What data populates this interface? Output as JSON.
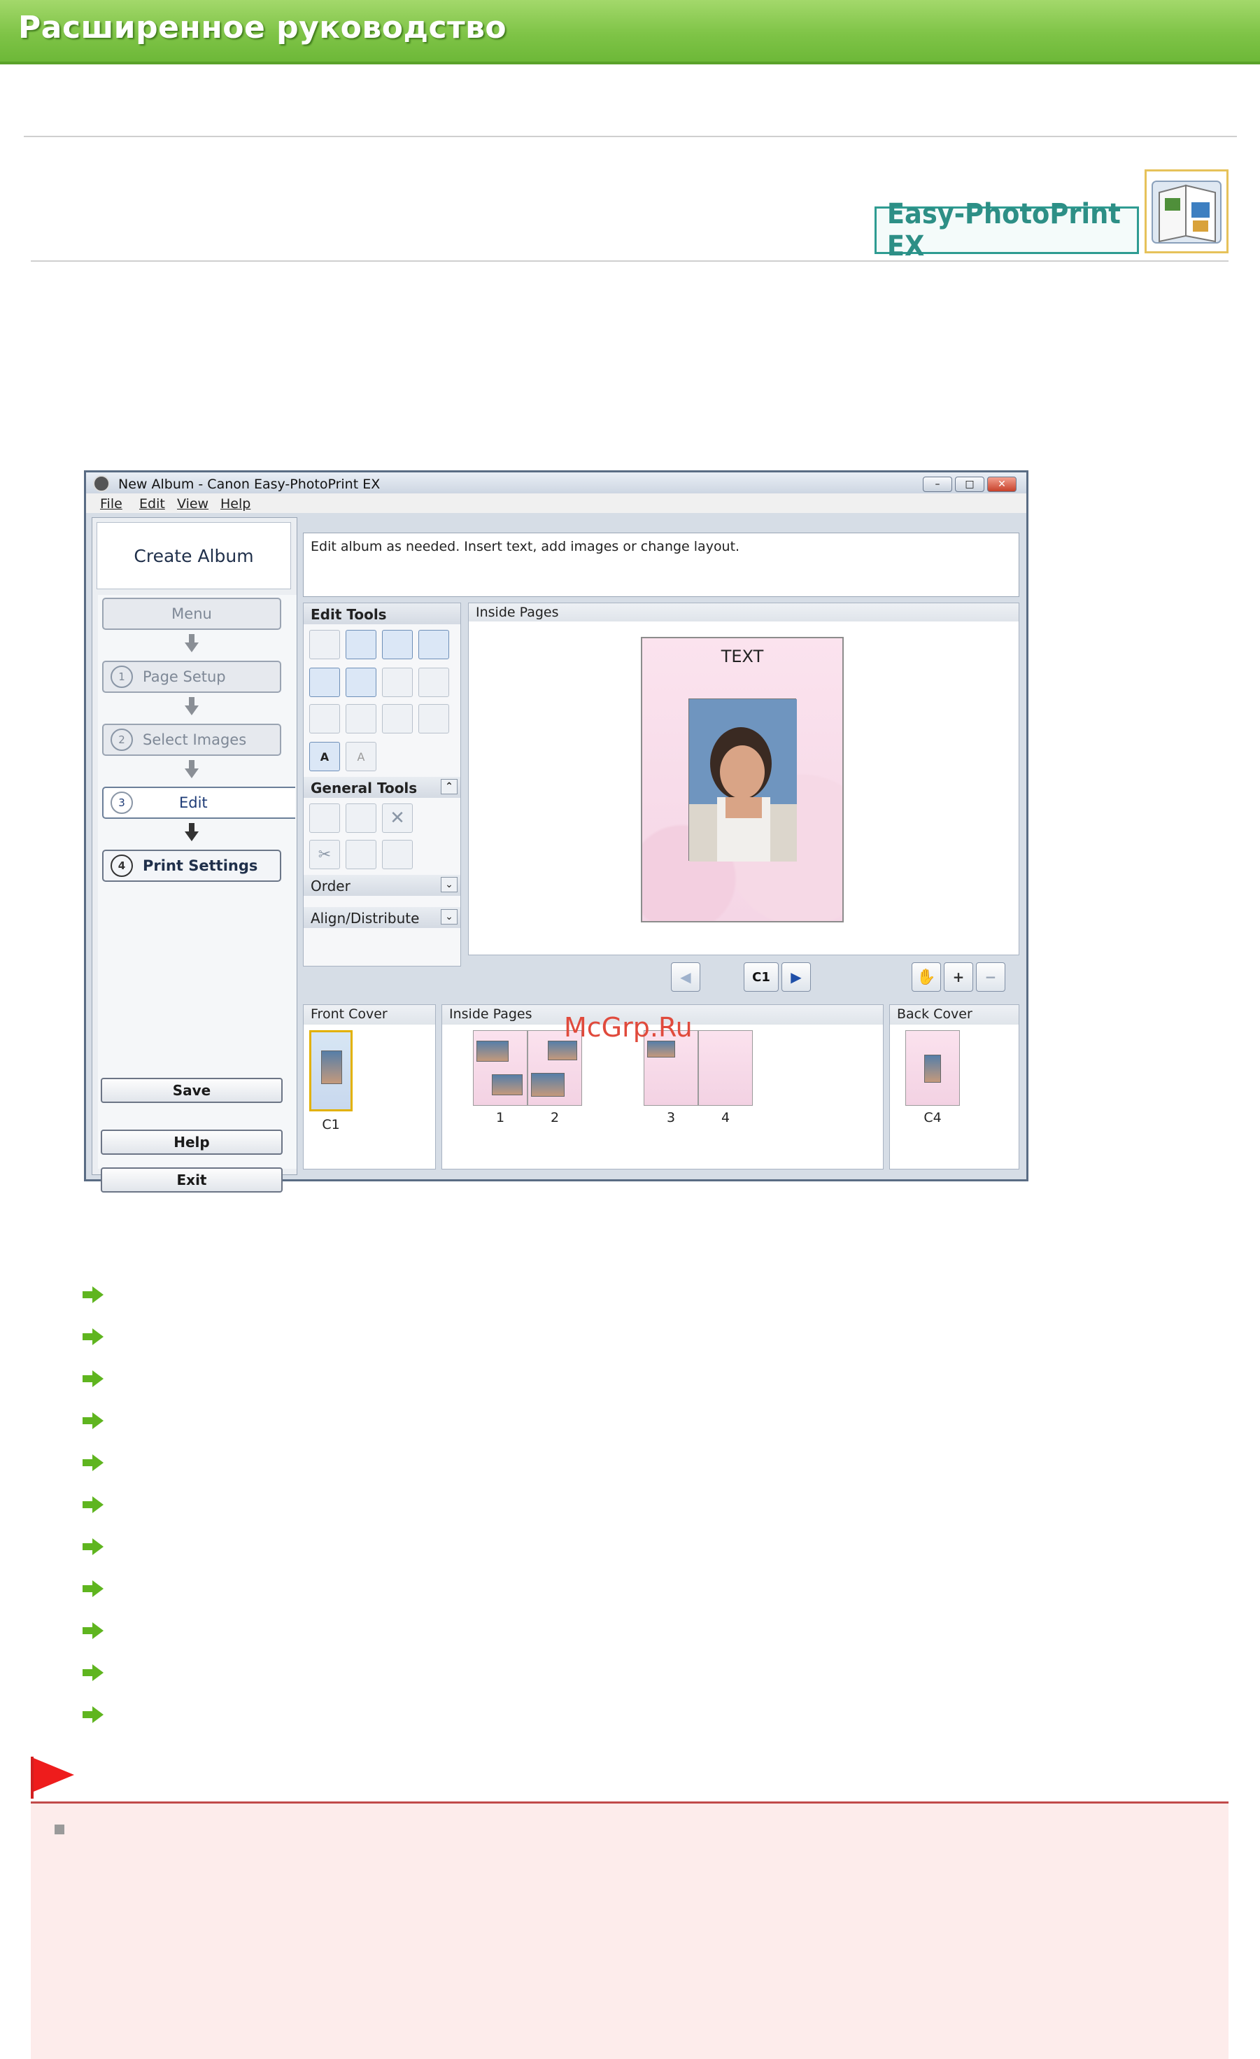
{
  "banner": {
    "title": "Расширенное руководство"
  },
  "logo": {
    "text": "Easy-PhotoPrint EX",
    "icon": "album-book-icon"
  },
  "app": {
    "window_title": "New Album - Canon Easy-PhotoPrint EX",
    "menus": [
      "File",
      "Edit",
      "View",
      "Help"
    ],
    "header": "Create Album",
    "steps": {
      "menu": "Menu",
      "page_setup": "Page Setup",
      "page_setup_num": "1",
      "select_images": "Select Images",
      "select_images_num": "2",
      "edit": "Edit",
      "edit_num": "3",
      "print_settings": "Print Settings",
      "print_settings_num": "4"
    },
    "buttons": {
      "save": "Save",
      "help": "Help",
      "exit": "Exit"
    },
    "instruction": "Edit album as needed. Insert text, add images or change layout.",
    "panels": {
      "edit_tools": "Edit Tools",
      "general_tools": "General Tools",
      "order": "Order",
      "align_distribute": "Align/Distribute",
      "inside_pages": "Inside Pages"
    },
    "page_preview": {
      "text": "TEXT"
    },
    "navigation": {
      "current_page": "C1"
    },
    "thumbnails": {
      "front_cover": {
        "label": "Front Cover",
        "pages": [
          "C1"
        ]
      },
      "inside_pages": {
        "label": "Inside Pages",
        "pages": [
          "1",
          "2",
          "3",
          "4"
        ]
      },
      "back_cover": {
        "label": "Back Cover",
        "pages": [
          "C4"
        ]
      }
    }
  },
  "watermark": "McGrp.Ru",
  "link_list": {
    "count": 11,
    "icon": "green-arrow-icon"
  },
  "note": {
    "flag_icon": "red-flag-icon",
    "bullet_icon": "square-bullet-icon"
  }
}
